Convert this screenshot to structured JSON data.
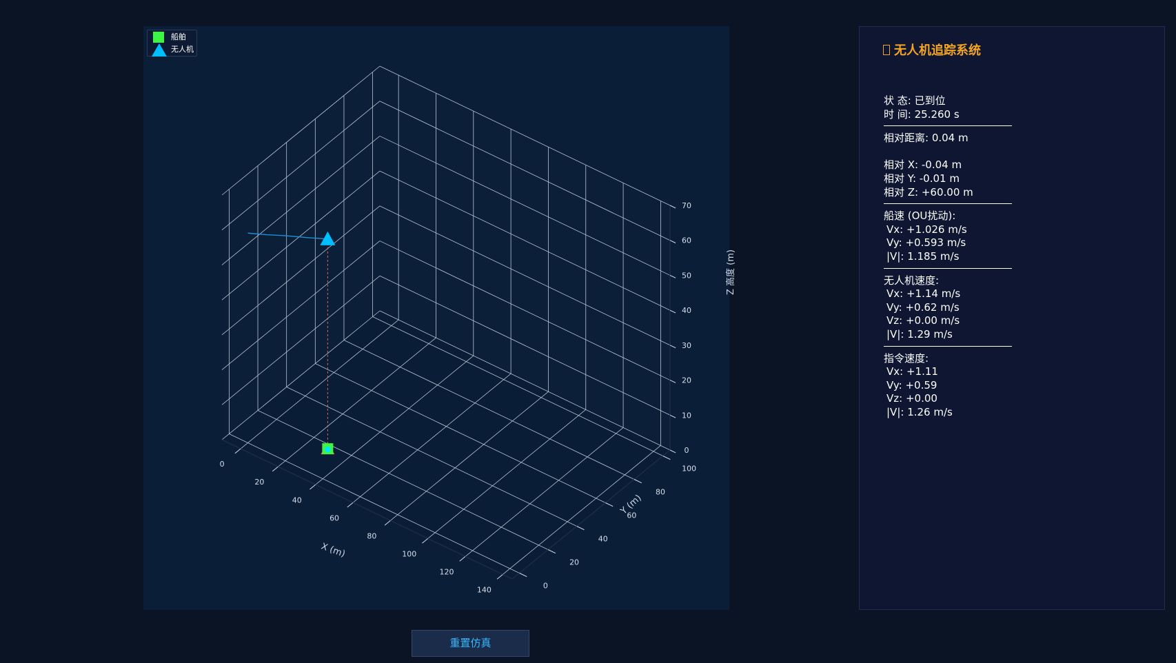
{
  "legend": {
    "ship_label": "船舶",
    "drone_label": "无人机"
  },
  "panel": {
    "title": "无人机追踪系统",
    "status": "状  态: 已到位",
    "time": "时  间: 25.260 s",
    "distance": "相对距离: 0.04 m",
    "rel_x": "相对 X: -0.04 m",
    "rel_y": "相对 Y: -0.01 m",
    "rel_z": "相对 Z: +60.00 m",
    "ship_speed_header": "船速 (OU扰动):",
    "ship_vx": "Vx: +1.026 m/s",
    "ship_vy": "Vy: +0.593 m/s",
    "ship_v": "|V|: 1.185 m/s",
    "drone_speed_header": "无人机速度:",
    "drone_vx": "Vx: +1.14 m/s",
    "drone_vy": "Vy: +0.62 m/s",
    "drone_vz": "Vz: +0.00 m/s",
    "drone_v": "|V|: 1.29 m/s",
    "cmd_speed_header": "指令速度:",
    "cmd_vx": "Vx: +1.11",
    "cmd_vy": "Vy: +0.59",
    "cmd_vz": "Vz: +0.00",
    "cmd_v": "|V|: 1.26 m/s"
  },
  "reset_button": "重置仿真",
  "colors": {
    "background": "#0b1424",
    "plot_background": "#0b1e38",
    "panel_background": "#0e1631",
    "title_accent": "#f5a524",
    "ship_marker": "#3cf545",
    "drone_marker": "#00bfff",
    "drone_trajectory": "#1e90d8",
    "link_line": "#e0695a",
    "button_text": "#35b8ff"
  },
  "chart_data": {
    "type": "scatter",
    "xlabel": "X (m)",
    "ylabel": "Y (m)",
    "zlabel": "Z 高度 (m)",
    "xlim": [
      -10,
      145
    ],
    "ylim": [
      -5,
      105
    ],
    "zlim": [
      0,
      70
    ],
    "x_ticks": [
      0,
      20,
      40,
      60,
      80,
      100,
      120,
      140
    ],
    "y_ticks": [
      0,
      20,
      40,
      60,
      80,
      100
    ],
    "z_ticks": [
      0,
      10,
      20,
      30,
      40,
      50,
      60,
      70
    ],
    "grid": true,
    "legend_position": "top-left",
    "series": [
      {
        "name": "船舶",
        "marker": "square",
        "points": [
          {
            "x": 29.3,
            "y": 17.4,
            "z": 0
          }
        ]
      },
      {
        "name": "无人机",
        "marker": "triangle",
        "points": [
          {
            "x": 29.3,
            "y": 17.4,
            "z": 60
          }
        ]
      }
    ],
    "drone_trajectory": [
      {
        "x": 0,
        "y": 0,
        "z": 60
      },
      {
        "x": 7,
        "y": 4,
        "z": 60
      },
      {
        "x": 14,
        "y": 8.5,
        "z": 60
      },
      {
        "x": 22,
        "y": 13,
        "z": 60
      },
      {
        "x": 29.3,
        "y": 17.4,
        "z": 60
      }
    ]
  }
}
